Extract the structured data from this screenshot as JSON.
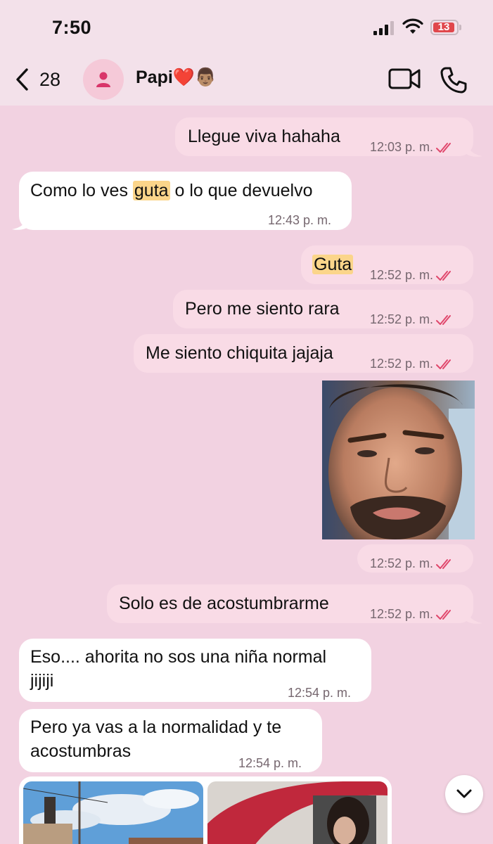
{
  "status_bar": {
    "time": "7:50",
    "battery": "13"
  },
  "header": {
    "back_count": "28",
    "contact_name": "Papi❤️👨🏽"
  },
  "colors": {
    "tick": "#e0476c",
    "background": "#f2d2e1",
    "outgoing": "#f9dbe6",
    "incoming": "#ffffff",
    "highlight": "#fbd58a"
  },
  "messages": [
    {
      "dir": "out",
      "text": "Llegue viva hahaha",
      "time": "12:03 p. m."
    },
    {
      "dir": "in",
      "text_before": "Como lo ves ",
      "highlight": "guta",
      "text_after": " o lo que devuelvo",
      "time": "12:43 p. m."
    },
    {
      "dir": "out",
      "highlight": "Guta",
      "time": "12:52 p. m."
    },
    {
      "dir": "out",
      "text": "Pero me siento rara",
      "time": "12:52 p. m."
    },
    {
      "dir": "out",
      "text": "Me siento chiquita jajaja",
      "time": "12:52 p. m."
    },
    {
      "dir": "out",
      "kind": "photo",
      "time": "12:52 p. m."
    },
    {
      "dir": "out",
      "text": "Solo es de acostumbrarme",
      "time": "12:52 p. m."
    },
    {
      "dir": "in",
      "line1": "Eso.... ahorita no sos una niña normal",
      "line2": "jijiji",
      "time": "12:54 p. m."
    },
    {
      "dir": "in",
      "line1": "Pero ya vas a la normalidad y te",
      "line2": "acostumbras",
      "time": "12:54 p. m."
    }
  ]
}
